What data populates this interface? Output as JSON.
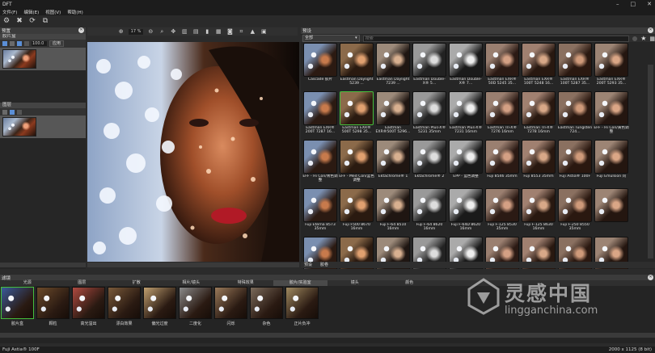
{
  "window": {
    "title": "DFT"
  },
  "menu": [
    "文件(F)",
    "编辑(E)",
    "视图(V)",
    "帮助(H)"
  ],
  "left": {
    "presets_title": "预置",
    "film_section": "胶片盒",
    "value": "100.0",
    "apply_button": "应用",
    "layers_title": "图层"
  },
  "viewer": {
    "zoom": "17 %"
  },
  "right": {
    "panel_title": "预设",
    "category": "全部",
    "search_placeholder": "搜索",
    "tabs": [
      "预设",
      "胶卷"
    ],
    "presets": [
      {
        "label": "Cascade 胶片"
      },
      {
        "label": "Eastman Daylight 5239 ..."
      },
      {
        "label": "Eastman Daylight 7239 ..."
      },
      {
        "label": "Eastman Double-X® 5..."
      },
      {
        "label": "Eastman Double-X® 7..."
      },
      {
        "label": "Eastman EXR® 50D 5245 35..."
      },
      {
        "label": "Eastman EXR® 100T 5248 16..."
      },
      {
        "label": "Eastman EXR® 100T 5287 35..."
      },
      {
        "label": "Eastman EXR® 200T 5293 35..."
      },
      {
        "label": "Eastman EXR® 200T 7287 16..."
      },
      {
        "label": "Eastman EXR® 500T 5298 35..."
      },
      {
        "label": "Eastman EXR®500T 5296..."
      },
      {
        "label": "Eastman Plus-X® 5231 35mm"
      },
      {
        "label": "Eastman Plus-X® 7231 16mm"
      },
      {
        "label": "Eastman Tri-X® 7276 16mm"
      },
      {
        "label": "Eastman Tri-X® 7278 16mm"
      },
      {
        "label": "Eastman Tungsten 724..."
      },
      {
        "label": "EFF - Hi Con/黄色调整"
      },
      {
        "label": "EFF - Hi Con/青色调整"
      },
      {
        "label": "EFF - Med Con/蓝色调整"
      },
      {
        "label": "Ektachrome® 1"
      },
      {
        "label": "Ektachrome® 2"
      },
      {
        "label": "EPP - 蓝色调整"
      },
      {
        "label": "Fuji 8546 35mm"
      },
      {
        "label": "Fuji 8553 35mm"
      },
      {
        "label": "Fuji Astia® 100F"
      },
      {
        "label": "Fuji Emulsion 问"
      },
      {
        "label": "Fuji Eterna 8573 35mm"
      },
      {
        "label": "Fuji F500 8670 16mm"
      },
      {
        "label": "Fuji F-64 8510 16mm"
      },
      {
        "label": "Fuji F-64 8620 16mm"
      },
      {
        "label": "Fuji F-64D 8620 16mm"
      },
      {
        "label": "Fuji F-125 8530 35mm"
      },
      {
        "label": "Fuji F-125 8630 16mm"
      },
      {
        "label": "Fuji F-250 8550 35mm"
      },
      {
        "label": ""
      },
      {
        "label": ""
      },
      {
        "label": ""
      },
      {
        "label": ""
      },
      {
        "label": ""
      },
      {
        "label": ""
      },
      {
        "label": ""
      },
      {
        "label": ""
      },
      {
        "label": ""
      },
      {
        "label": ""
      }
    ]
  },
  "bottom": {
    "title": "滤镜",
    "tabs": [
      "光源",
      "图层",
      "扩散",
      "相片/镜头",
      "特殊效果",
      "胶片/实验室",
      "镜头",
      "颜色",
      "",
      "",
      "",
      ""
    ],
    "active_tab": 5,
    "items": [
      {
        "label": "胶片盒"
      },
      {
        "label": "颗粒"
      },
      {
        "label": "高光溢出"
      },
      {
        "label": "漂白效果"
      },
      {
        "label": "偏光过度"
      },
      {
        "label": "二度化"
      },
      {
        "label": "闪烁"
      },
      {
        "label": "杂色"
      },
      {
        "label": "正片负冲"
      }
    ]
  },
  "status": {
    "left": "Fuji Astia® 100F",
    "right": "2000 x 1125 (8 bit)"
  },
  "watermark": {
    "brand": "灵感中国",
    "url": "lingganchina.com"
  }
}
